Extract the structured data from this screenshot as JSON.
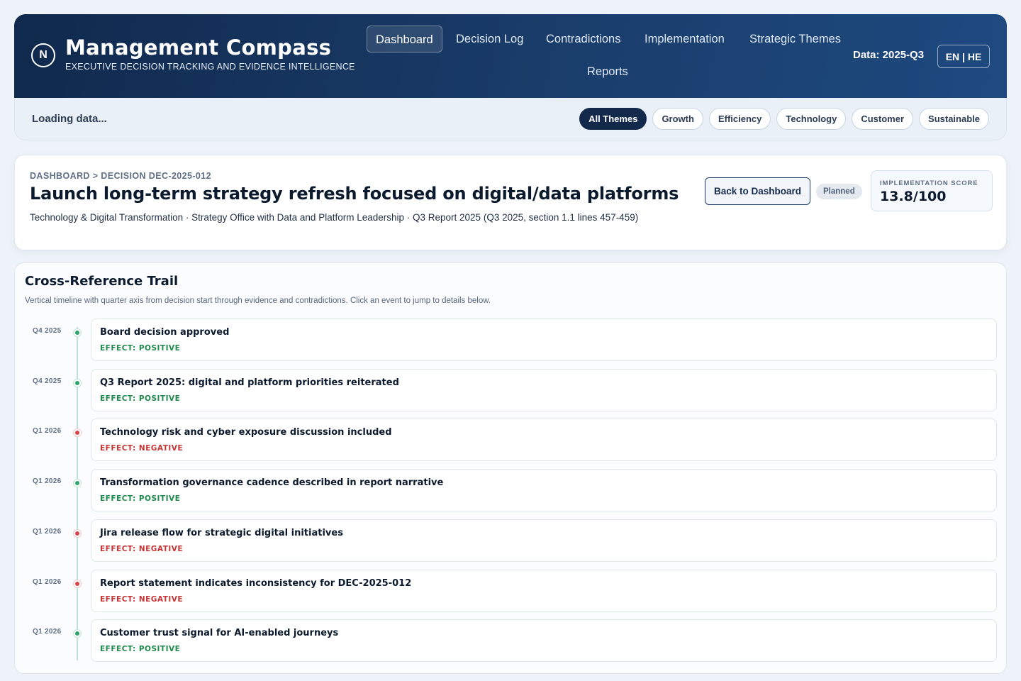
{
  "header": {
    "logo_letter": "N",
    "title": "Management Compass",
    "subtitle": "EXECUTIVE DECISION TRACKING AND EVIDENCE INTELLIGENCE",
    "nav": [
      {
        "label": "Dashboard",
        "active": true
      },
      {
        "label": "Decision Log"
      },
      {
        "label": "Contradictions"
      },
      {
        "label": "Implementation"
      },
      {
        "label": "Strategic Themes"
      },
      {
        "label": "Reports"
      }
    ],
    "data_label": "Data: 2025-Q3",
    "lang": "EN | HE"
  },
  "filters": {
    "status": "Loading data...",
    "themes": [
      "All Themes",
      "Growth",
      "Efficiency",
      "Technology",
      "Customer",
      "Sustainable"
    ],
    "active_theme": "All Themes"
  },
  "decision": {
    "breadcrumb": "DASHBOARD > DECISION DEC-2025-012",
    "title": "Launch long-term strategy refresh focused on digital/data platforms",
    "meta": "Technology & Digital Transformation · Strategy Office with Data and Platform Leadership · Q3 Report 2025 (Q3 2025, section 1.1 lines 457-459)",
    "back_label": "Back to Dashboard",
    "status": "Planned",
    "score_label": "IMPLEMENTATION SCORE",
    "score_value": "13.8/100"
  },
  "trail": {
    "title": "Cross-Reference Trail",
    "description": "Vertical timeline with quarter axis from decision start through evidence and contradictions. Click an event to jump to details below.",
    "events": [
      {
        "quarter": "Q4 2025",
        "title": "Board decision approved",
        "effect": "EFFECT: POSITIVE",
        "kind": "positive"
      },
      {
        "quarter": "Q4 2025",
        "title": "Q3 Report 2025: digital and platform priorities reiterated",
        "effect": "EFFECT: POSITIVE",
        "kind": "positive"
      },
      {
        "quarter": "Q1 2026",
        "title": "Technology risk and cyber exposure discussion included",
        "effect": "EFFECT: NEGATIVE",
        "kind": "negative"
      },
      {
        "quarter": "Q1 2026",
        "title": "Transformation governance cadence described in report narrative",
        "effect": "EFFECT: POSITIVE",
        "kind": "positive"
      },
      {
        "quarter": "Q1 2026",
        "title": "Jira release flow for strategic digital initiatives",
        "effect": "EFFECT: NEGATIVE",
        "kind": "negative"
      },
      {
        "quarter": "Q1 2026",
        "title": "Report statement indicates inconsistency for DEC-2025-012",
        "effect": "EFFECT: NEGATIVE",
        "kind": "negative"
      },
      {
        "quarter": "Q1 2026",
        "title": "Customer trust signal for AI-enabled journeys",
        "effect": "EFFECT: POSITIVE",
        "kind": "positive"
      }
    ]
  }
}
